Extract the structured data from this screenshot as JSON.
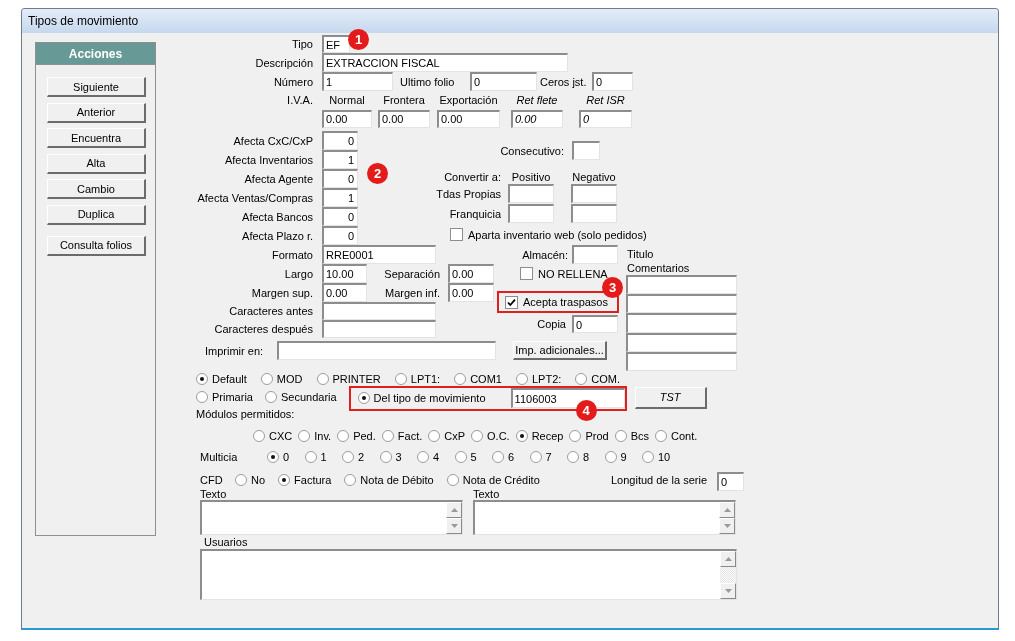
{
  "window": {
    "title": "Tipos de movimiento"
  },
  "sidebar": {
    "title": "Acciones",
    "buttons": [
      "Siguiente",
      "Anterior",
      "Encuentra",
      "Alta",
      "Cambio",
      "Duplica",
      "Consulta folios"
    ]
  },
  "tipo": {
    "label": "Tipo",
    "value": "EF",
    "callout": "1"
  },
  "descripcion": {
    "label": "Descripción",
    "value": "EXTRACCION FISCAL"
  },
  "numero": {
    "label": "Número",
    "value": "1"
  },
  "ultimo_folio": {
    "label": "Ultimo folio",
    "value": "0"
  },
  "ceros_jst": {
    "label": "Ceros jst.",
    "value": "0"
  },
  "iva": {
    "label": "I.V.A.",
    "columns": [
      {
        "label": "Normal",
        "value": "0.00",
        "kind": "rate"
      },
      {
        "label": "Frontera",
        "value": "0.00",
        "kind": "rate"
      },
      {
        "label": "Exportación",
        "value": "0.00",
        "kind": "rate"
      },
      {
        "label": "Ret flete",
        "value": "0.00",
        "kind": "retention"
      },
      {
        "label": "Ret ISR",
        "value": "0",
        "kind": "retention"
      }
    ]
  },
  "afecta": {
    "callout": "2",
    "rows": [
      {
        "label": "Afecta CxC/CxP",
        "value": "0"
      },
      {
        "label": "Afecta Inventarios",
        "value": "1"
      },
      {
        "label": "Afecta Agente",
        "value": "0"
      },
      {
        "label": "Afecta Ventas/Compras",
        "value": "1"
      },
      {
        "label": "Afecta Bancos",
        "value": "0"
      },
      {
        "label": "Afecta Plazo r.",
        "value": "0"
      }
    ]
  },
  "consecutivo": {
    "label": "Consecutivo:"
  },
  "convertir": {
    "label": "Convertir a:",
    "columns": [
      "Positivo",
      "Negativo"
    ],
    "rows": [
      "Tdas Propias",
      "Franquicia"
    ]
  },
  "aparta_inventario_web": {
    "label": "Aparta inventario web (solo pedidos)",
    "checked": false
  },
  "formato": {
    "label": "Formato",
    "value": "RRE0001"
  },
  "largo": {
    "label": "Largo",
    "value": "10.00"
  },
  "separacion": {
    "label": "Separación",
    "value": "0.00"
  },
  "margen_sup": {
    "label": "Margen sup.",
    "value": "0.00"
  },
  "margen_inf": {
    "label": "Margen inf.",
    "value": "0.00"
  },
  "caracteres_antes": {
    "label": "Caracteres antes"
  },
  "caracteres_despues": {
    "label": "Caracteres después"
  },
  "almacen": {
    "label": "Almacén:"
  },
  "no_rellena": {
    "label": "NO RELLENA",
    "checked": false
  },
  "acepta_traspasos": {
    "label": "Acepta traspasos",
    "checked": true,
    "highlighted": true,
    "callout": "3"
  },
  "copia": {
    "label": "Copia",
    "value": "0"
  },
  "comentarios": {
    "title_label": "Titulo",
    "label": "Comentarios"
  },
  "imprimir_en": {
    "label": "Imprimir en:"
  },
  "imp_adicionales_button": {
    "label": "Imp. adicionales..."
  },
  "port_options": [
    {
      "label": "Default",
      "selected": true
    },
    {
      "label": "MOD",
      "selected": false
    },
    {
      "label": "PRINTER",
      "selected": false
    },
    {
      "label": "LPT1:",
      "selected": false
    },
    {
      "label": "COM1",
      "selected": false
    },
    {
      "label": "LPT2:",
      "selected": false
    },
    {
      "label": "COM.",
      "selected": false
    }
  ],
  "source_options": [
    {
      "label": "Primaria",
      "selected": false
    },
    {
      "label": "Secundaria",
      "selected": false
    },
    {
      "label": "Del tipo de movimiento",
      "selected": true,
      "value": "1106003",
      "highlighted": true,
      "callout": "4"
    }
  ],
  "tst_button": {
    "label": "TST"
  },
  "modulos": {
    "label": "Módulos permitidos:",
    "options": [
      {
        "label": "CXC",
        "selected": false
      },
      {
        "label": "Inv.",
        "selected": false
      },
      {
        "label": "Ped.",
        "selected": false
      },
      {
        "label": "Fact.",
        "selected": false
      },
      {
        "label": "CxP",
        "selected": false
      },
      {
        "label": "O.C.",
        "selected": false
      },
      {
        "label": "Recep",
        "selected": true
      },
      {
        "label": "Prod",
        "selected": false
      },
      {
        "label": "Bcs",
        "selected": false
      },
      {
        "label": "Cont.",
        "selected": false
      }
    ]
  },
  "multicia": {
    "label": "Multicia",
    "options": [
      {
        "label": "0",
        "selected": true
      },
      {
        "label": "1",
        "selected": false
      },
      {
        "label": "2",
        "selected": false
      },
      {
        "label": "3",
        "selected": false
      },
      {
        "label": "4",
        "selected": false
      },
      {
        "label": "5",
        "selected": false
      },
      {
        "label": "6",
        "selected": false
      },
      {
        "label": "7",
        "selected": false
      },
      {
        "label": "8",
        "selected": false
      },
      {
        "label": "9",
        "selected": false
      },
      {
        "label": "10",
        "selected": false
      }
    ]
  },
  "cfd": {
    "label": "CFD",
    "options": [
      {
        "label": "No",
        "selected": false
      },
      {
        "label": "Factura",
        "selected": true
      },
      {
        "label": "Nota de Débito",
        "selected": false
      },
      {
        "label": "Nota de Crédito",
        "selected": false
      }
    ]
  },
  "longitud_serie": {
    "label": "Longitud de la serie",
    "value": "0"
  },
  "texto_boxes": [
    {
      "label": "Texto"
    },
    {
      "label": "Texto"
    }
  ],
  "usuarios": {
    "label": "Usuarios"
  }
}
